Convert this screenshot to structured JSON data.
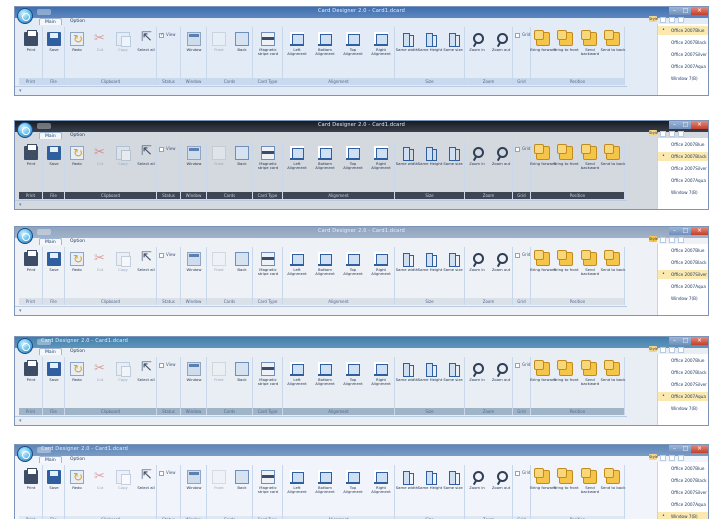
{
  "window": {
    "title": "Card Designer 2.0 - Card1.dcard"
  },
  "tabs": [
    "Main",
    "Option"
  ],
  "ribbon": {
    "groups": [
      {
        "key": "print",
        "label": "Print",
        "items": [
          {
            "label": "Print",
            "icon": "printer-icon",
            "enabled": true
          }
        ]
      },
      {
        "key": "file",
        "label": "File",
        "items": [
          {
            "label": "Save",
            "icon": "save-icon",
            "enabled": true
          }
        ]
      },
      {
        "key": "clipboard",
        "label": "Clipboard",
        "items": [
          {
            "label": "Redo",
            "icon": "redo-icon",
            "enabled": true
          },
          {
            "label": "Cut",
            "icon": "cut-icon",
            "enabled": false
          },
          {
            "label": "Copy",
            "icon": "copy-icon",
            "enabled": false
          },
          {
            "label": "Select all",
            "icon": "select-all-icon",
            "enabled": true
          }
        ]
      },
      {
        "key": "status",
        "label": "Status",
        "checkbox": "View"
      },
      {
        "key": "window",
        "label": "Window",
        "items": [
          {
            "label": "Window",
            "icon": "window-icon",
            "enabled": true
          }
        ]
      },
      {
        "key": "cards",
        "label": "Cards",
        "items": [
          {
            "label": "Front",
            "icon": "card-front-icon",
            "enabled": false
          },
          {
            "label": "Back",
            "icon": "card-back-icon",
            "enabled": true
          }
        ]
      },
      {
        "key": "cardtype",
        "label": "Card Type",
        "items": [
          {
            "label": "Magnetic stripe card",
            "icon": "magnetic-stripe-icon",
            "enabled": true
          }
        ]
      },
      {
        "key": "alignment",
        "label": "Alignment",
        "items": [
          {
            "label": "Left Alignment",
            "icon": "align-left-icon",
            "enabled": true
          },
          {
            "label": "Bottom Alignment",
            "icon": "align-bottom-icon",
            "enabled": true
          },
          {
            "label": "Top Alignment",
            "icon": "align-top-icon",
            "enabled": true
          },
          {
            "label": "Right Alignment",
            "icon": "align-right-icon",
            "enabled": true
          }
        ]
      },
      {
        "key": "size",
        "label": "Size",
        "items": [
          {
            "label": "Same width",
            "icon": "same-width-icon",
            "enabled": true
          },
          {
            "label": "Same Height",
            "icon": "same-height-icon",
            "enabled": true
          },
          {
            "label": "Same size",
            "icon": "same-size-icon",
            "enabled": true
          }
        ]
      },
      {
        "key": "zoom",
        "label": "Zoom",
        "items": [
          {
            "label": "Zoom in",
            "icon": "zoom-in-icon",
            "enabled": true
          },
          {
            "label": "Zoom out",
            "icon": "zoom-out-icon",
            "enabled": true
          }
        ]
      },
      {
        "key": "grid",
        "label": "Grid",
        "checkbox": "Grid"
      },
      {
        "key": "position",
        "label": "Position",
        "items": [
          {
            "label": "Bring forward",
            "icon": "bring-forward-icon",
            "enabled": true
          },
          {
            "label": "Bring to front",
            "icon": "bring-to-front-icon",
            "enabled": true
          },
          {
            "label": "Send backward",
            "icon": "send-backward-icon",
            "enabled": true
          },
          {
            "label": "Send to back",
            "icon": "send-to-back-icon",
            "enabled": true
          }
        ]
      }
    ]
  },
  "style_button": "Style",
  "style_options": [
    "Office 2007Blue",
    "Office 2007Black",
    "Office 2007Silver",
    "Office 2007Aqua",
    "Window 7(B)"
  ],
  "variants": [
    {
      "title_bar_color": "#3f6fb0",
      "ribbon_color": "#e2ebf6",
      "status_color": "#c9d9ee",
      "selected_style": 0,
      "view_checked": true,
      "title_position": "center"
    },
    {
      "title_bar_color": "#151c26",
      "ribbon_color": "#d4d9e0",
      "status_color": "#3e4653",
      "selected_style": 1,
      "view_checked": false,
      "title_position": "center"
    },
    {
      "title_bar_color": "#8ea3be",
      "ribbon_color": "#eef1f5",
      "status_color": "#dbe1e9",
      "selected_style": 2,
      "view_checked": false,
      "title_position": "center"
    },
    {
      "title_bar_color": "#3f7fab",
      "ribbon_color": "#e8eef3",
      "status_color": "#9fb4c7",
      "selected_style": 3,
      "view_checked": false,
      "title_position": "left"
    },
    {
      "title_bar_color": "#5d86b8",
      "ribbon_color": "#f1f5fb",
      "status_color": "#dfe7f2",
      "selected_style": 4,
      "view_checked": false,
      "title_position": "left"
    }
  ]
}
